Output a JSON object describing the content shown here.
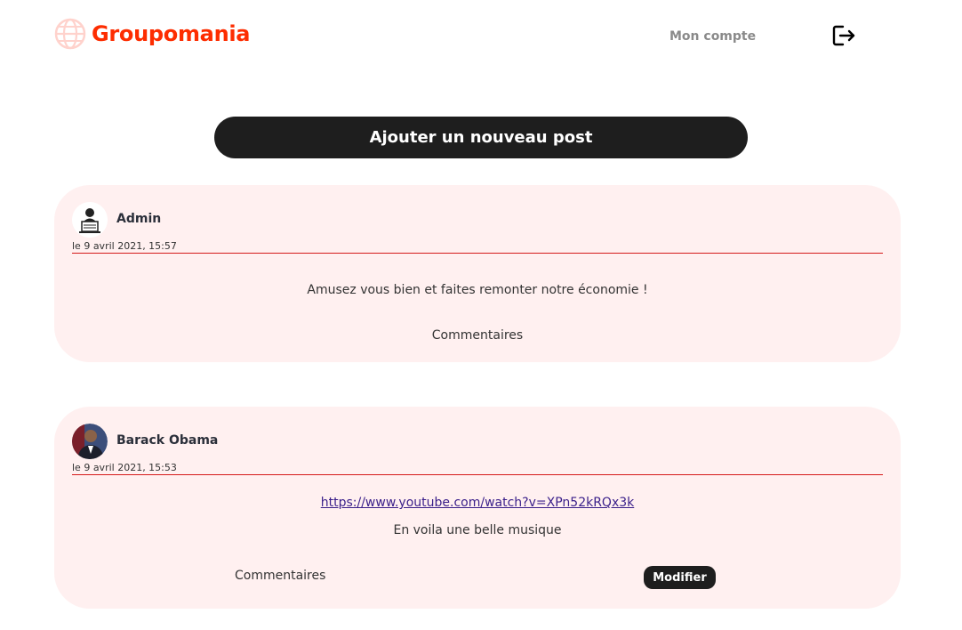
{
  "header": {
    "brand": "Groupomania",
    "account_link": "Mon compte",
    "logout_icon": "logout-icon"
  },
  "composer": {
    "add_post_label": "Ajouter un nouveau post"
  },
  "posts": [
    {
      "author": "Admin",
      "date": "le 9 avril 2021, 15:57",
      "text": "Amusez vous bien et faites remonter notre économie !",
      "comments_label": "Commentaires"
    },
    {
      "author": "Barack Obama",
      "date": "le 9 avril 2021, 15:53",
      "link": "https://www.youtube.com/watch?v=XPn52kRQx3k",
      "text": "En voila une belle musique",
      "comments_label": "Commentaires",
      "edit_label": "Modifier"
    }
  ],
  "colors": {
    "brand": "#fd2d01",
    "card_bg": "#fff0f0",
    "dark": "#1e1e1e"
  }
}
